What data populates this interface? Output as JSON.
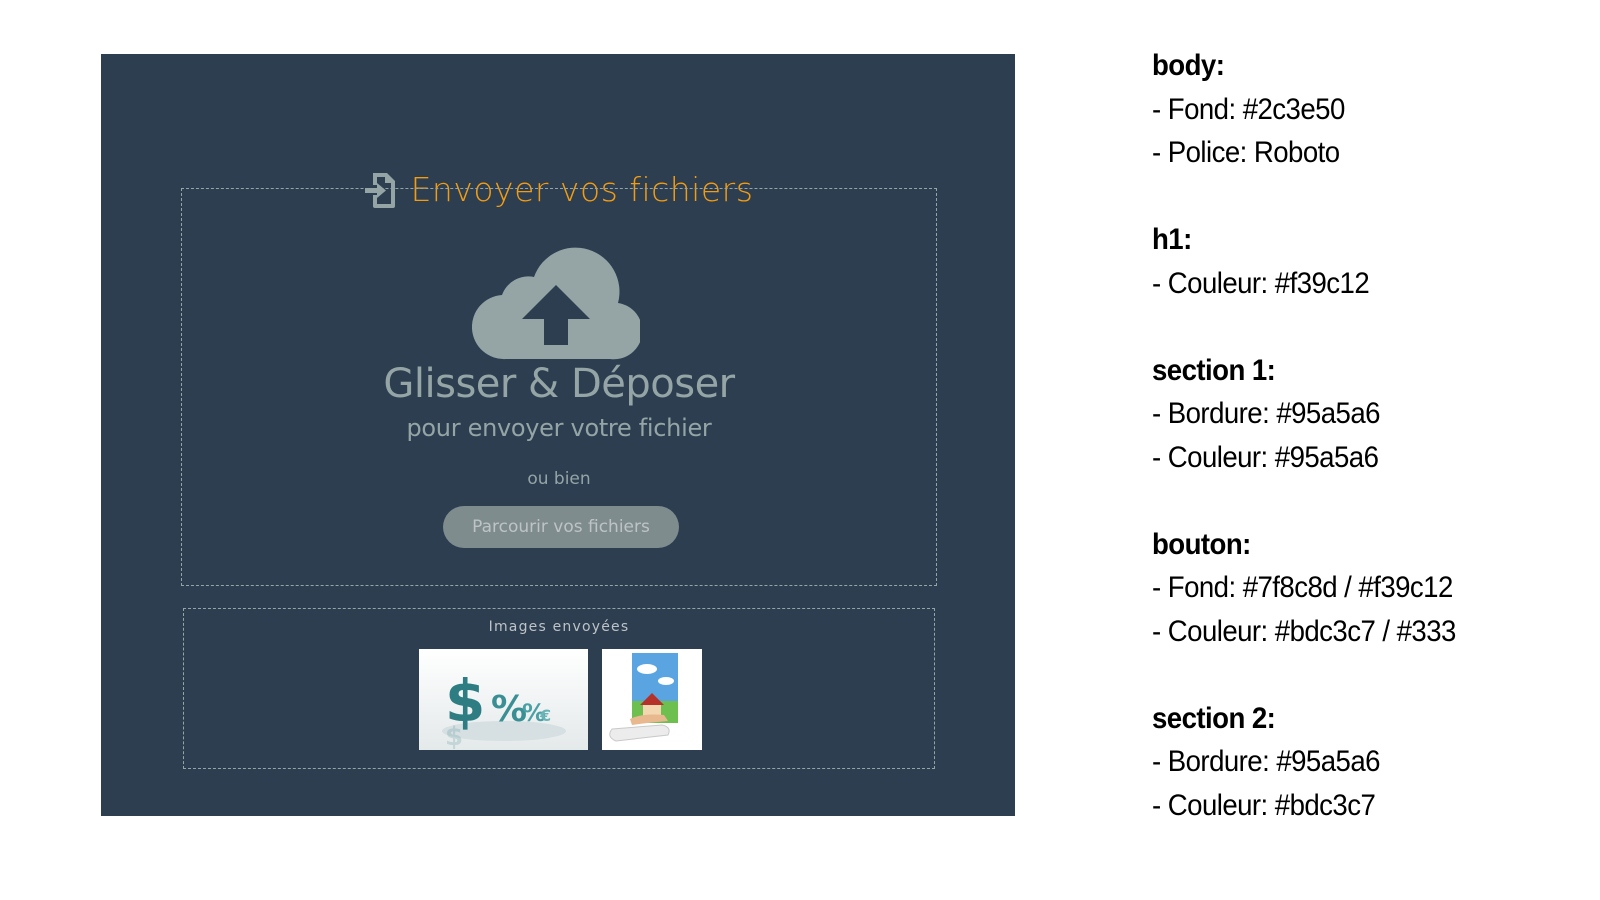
{
  "uploader": {
    "title": "Envoyer vos fichiers",
    "drop_zone": {
      "heading": "Glisser & Déposer",
      "subheading": "pour envoyer votre fichier",
      "or_text": "ou bien",
      "browse_button": "Parcourir vos fichiers"
    },
    "uploaded_section": {
      "label": "Images envoyées",
      "thumbnails": [
        "dollar-percent-image",
        "house-in-hand-image"
      ]
    },
    "icons": {
      "title": "file-import-icon",
      "drop": "cloud-upload-icon"
    }
  },
  "notes": [
    {
      "heading": "body:",
      "lines": [
        "Fond: #2c3e50",
        "Police: Roboto"
      ]
    },
    {
      "heading": "h1:",
      "lines": [
        "Couleur: #f39c12"
      ]
    },
    {
      "heading": "section 1:",
      "lines": [
        "Bordure: #95a5a6",
        "Couleur: #95a5a6"
      ]
    },
    {
      "heading": "bouton:",
      "lines": [
        "Fond: #7f8c8d / #f39c12",
        "Couleur: #bdc3c7 / #333"
      ]
    },
    {
      "heading": "section 2:",
      "lines": [
        "Bordure: #95a5a6",
        "Couleur: #bdc3c7"
      ]
    }
  ],
  "colors": {
    "background": "#2c3e50",
    "accent": "#f39c12",
    "muted": "#95a5a6",
    "button_bg": "#7f8c8d",
    "button_text": "#bdc3c7"
  }
}
